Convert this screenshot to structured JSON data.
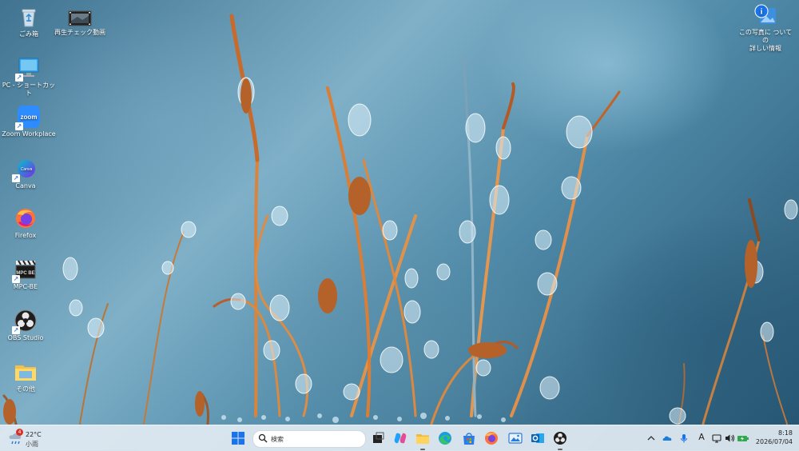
{
  "desktop": {
    "icons": [
      {
        "label": "ごみ箱"
      },
      {
        "label": "再生チェック動画"
      },
      {
        "label": "PC - ショートカット"
      },
      {
        "label": "Zoom Workplace",
        "logo_text": "zoom"
      },
      {
        "label": "Canva",
        "logo_text": "Canva"
      },
      {
        "label": "Firefox"
      },
      {
        "label": "MPC-BE",
        "logo_text": "MPC BE"
      },
      {
        "label": "OBS Studio"
      },
      {
        "label": "その他"
      },
      {
        "label_line1": "この写真に ついての",
        "label_line2": "詳しい情報"
      }
    ]
  },
  "taskbar": {
    "weather": {
      "temp": "22°C",
      "condition": "小雨",
      "badge": "4"
    },
    "search_placeholder": "検索",
    "clock": {
      "time": "8:18",
      "date": "2026/07/04"
    },
    "ime_label": "A"
  },
  "colors": {
    "taskbar_bg": "#e1ebf2",
    "start_blue": "#1a73e8",
    "zoom_blue": "#2d8cff",
    "firefox_orange": "#ff7139",
    "weather_badge": "#d93025"
  }
}
